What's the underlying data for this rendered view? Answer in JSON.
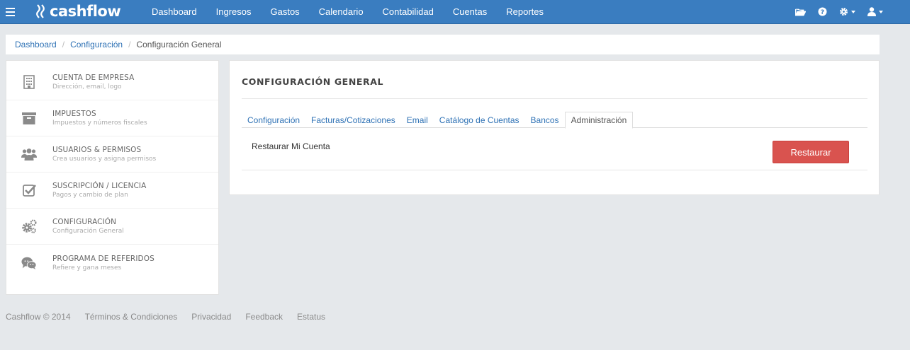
{
  "app": {
    "logo_text": "cashflow",
    "menu_icon": "hamburger-menu-icon"
  },
  "nav": {
    "items": [
      {
        "label": "Dashboard"
      },
      {
        "label": "Ingresos"
      },
      {
        "label": "Gastos"
      },
      {
        "label": "Calendario"
      },
      {
        "label": "Contabilidad"
      },
      {
        "label": "Cuentas"
      },
      {
        "label": "Reportes"
      }
    ],
    "right_icons": [
      "folder-open-icon",
      "help-circle-icon",
      "gear-icon",
      "user-icon"
    ]
  },
  "breadcrumb": {
    "items": [
      {
        "label": "Dashboard"
      },
      {
        "label": "Configuración"
      }
    ],
    "current": "Configuración General"
  },
  "sidebar": {
    "items": [
      {
        "title": "CUENTA DE EMPRESA",
        "subtitle": "Dirección, email, logo",
        "icon": "building-icon"
      },
      {
        "title": "IMPUESTOS",
        "subtitle": "Impuestos y números fiscales",
        "icon": "archive-box-icon"
      },
      {
        "title": "USUARIOS & PERMISOS",
        "subtitle": "Crea usuarios y asigna permisos",
        "icon": "users-icon"
      },
      {
        "title": "SUSCRIPCIÓN / LICENCIA",
        "subtitle": "Pagos y cambio de plan",
        "icon": "checkbox-icon"
      },
      {
        "title": "CONFIGURACIÓN",
        "subtitle": "Configuración General",
        "icon": "gears-icon"
      },
      {
        "title": "PROGRAMA DE REFERIDOS",
        "subtitle": "Refiere y gana meses",
        "icon": "chat-bubbles-icon"
      }
    ]
  },
  "main": {
    "title": "CONFIGURACIÓN GENERAL",
    "tabs": [
      {
        "label": "Configuración"
      },
      {
        "label": "Facturas/Cotizaciones"
      },
      {
        "label": "Email"
      },
      {
        "label": "Catálogo de Cuentas"
      },
      {
        "label": "Bancos"
      },
      {
        "label": "Administración"
      }
    ],
    "active_tab": "Administración",
    "row_label": "Restaurar Mi Cuenta",
    "restore_button": "Restaurar"
  },
  "footer": {
    "copyright": "Cashflow © 2014",
    "links": [
      {
        "label": "Términos & Condiciones"
      },
      {
        "label": "Privacidad"
      },
      {
        "label": "Feedback"
      },
      {
        "label": "Estatus"
      }
    ]
  },
  "colors": {
    "navbar": "#3a7dc0",
    "link": "#2f72b5",
    "danger": "#d9534f",
    "background": "#e5e8eb"
  }
}
